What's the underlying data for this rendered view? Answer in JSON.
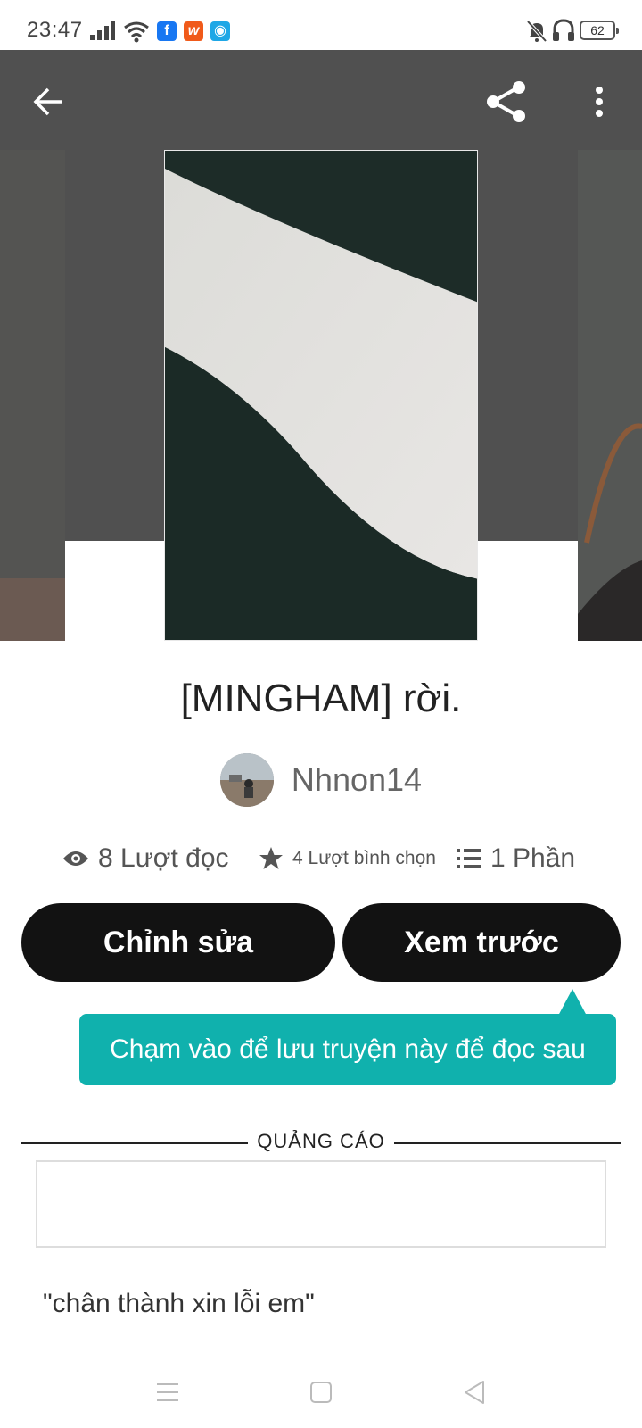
{
  "status_bar": {
    "time": "23:47",
    "battery": "62",
    "app_icons": [
      "facebook-icon",
      "wattpad-icon",
      "eye-app-icon"
    ]
  },
  "nav": {
    "back_icon": "arrow-left-icon",
    "share_icon": "share-icon",
    "more_icon": "more-vertical-icon"
  },
  "story": {
    "title": "[MINGHAM] rời.",
    "author": "Nhnon14",
    "reads": "8 Lượt đọc",
    "votes": "4 Lượt bình chọn",
    "parts": "1 Phần",
    "description": "\"chân thành xin lỗi em\""
  },
  "actions": {
    "edit_label": "Chỉnh sửa",
    "preview_label": "Xem trước"
  },
  "tooltip": {
    "text": "Chạm vào để lưu truyện này để đọc sau"
  },
  "ad": {
    "label": "QUẢNG CÁO"
  },
  "colors": {
    "header_bg": "#505050",
    "button_bg": "#121212",
    "tooltip_bg": "#10b1ad"
  }
}
